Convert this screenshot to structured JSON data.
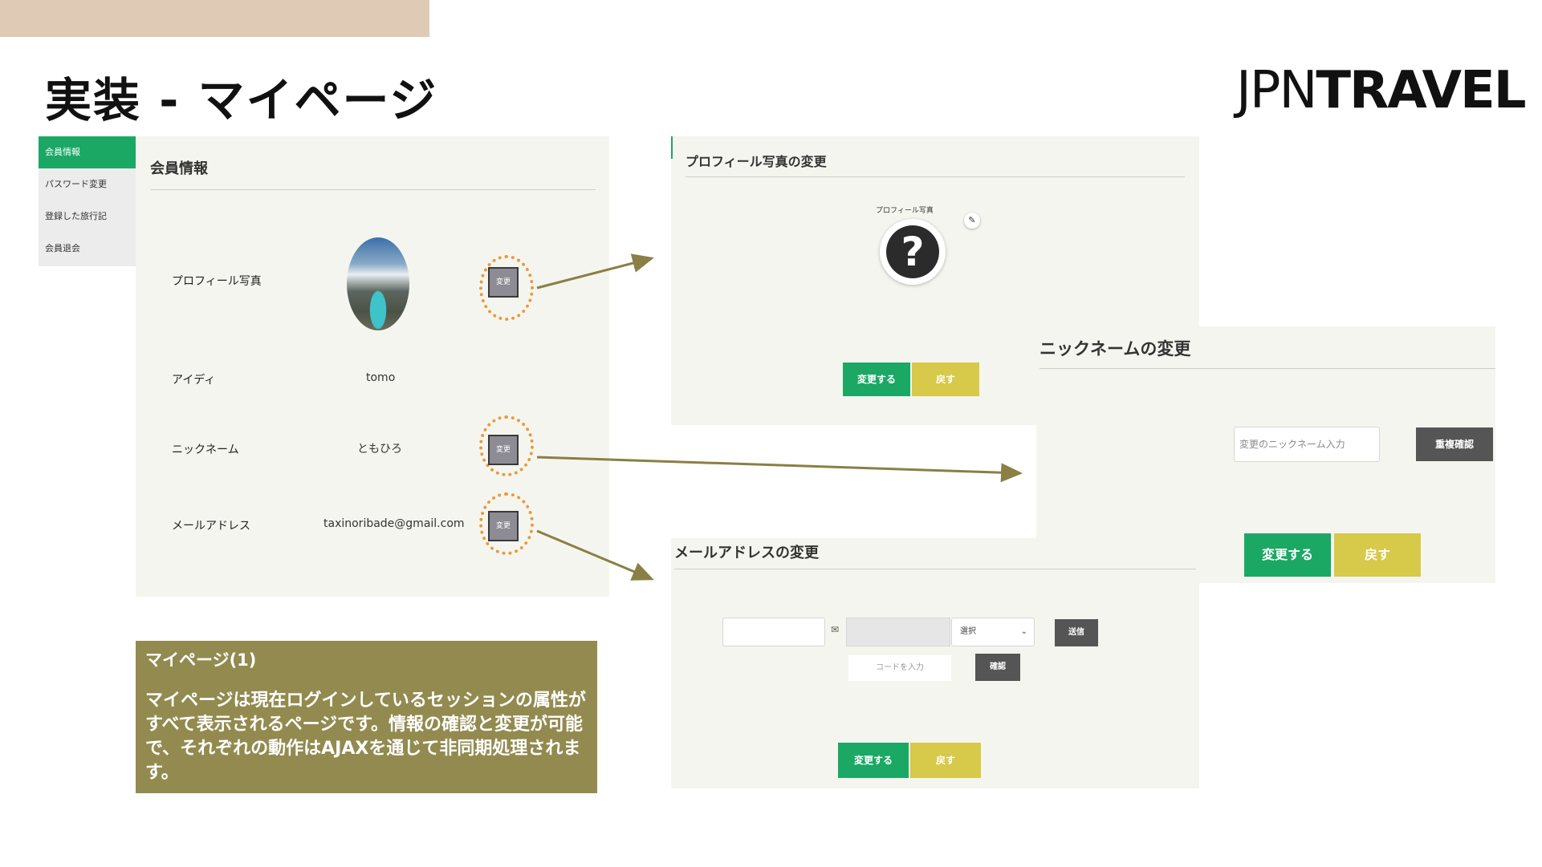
{
  "slide": {
    "title": "実装 - マイページ",
    "logo_thin": "JPN",
    "logo_bold": "TRAVEL"
  },
  "sidebar": {
    "items": [
      {
        "label": "会員情報",
        "active": true
      },
      {
        "label": "パスワード変更",
        "active": false
      },
      {
        "label": "登録した旅行記",
        "active": false
      },
      {
        "label": "会員退会",
        "active": false
      }
    ]
  },
  "member_info": {
    "heading": "会員情報",
    "rows": [
      {
        "label": "プロフィール写真",
        "value": "",
        "button": "変更"
      },
      {
        "label": "アイディ",
        "value": "tomo",
        "button": ""
      },
      {
        "label": "ニックネーム",
        "value": "ともひろ",
        "button": "変更"
      },
      {
        "label": "メールアドレス",
        "value": "taxinoribade@gmail.com",
        "button": "変更"
      }
    ]
  },
  "photo_change": {
    "heading": "プロフィール写真の変更",
    "caption": "プロフィール写真",
    "placeholder_icon": "question-mark-icon",
    "edit_icon": "pencil-icon",
    "submit_label": "変更する",
    "back_label": "戻す"
  },
  "nickname_change": {
    "heading": "ニックネームの変更",
    "input_placeholder": "変更のニックネーム入力",
    "check_label": "重複確認",
    "submit_label": "変更する",
    "back_label": "戻す"
  },
  "email_change": {
    "heading": "メールアドレスの変更",
    "envelope_icon": "envelope-icon",
    "domain_select": "選択",
    "send_label": "送信",
    "code_placeholder": "コードを入力",
    "confirm_label": "確認",
    "submit_label": "変更する",
    "back_label": "戻す"
  },
  "caption": {
    "title": "マイページ(1)",
    "body": "マイページは現在ログインしているセッションの属性がすべて表示されるページです。情報の確認と変更が可能で、それぞれの動作はAJAXを通じて非同期処理されます。"
  },
  "colors": {
    "accent_green": "#1aa864",
    "button_yellow": "#d7c949",
    "panel_bg": "#f5f5ef",
    "caption_bg": "#938a50",
    "ring_orange": "#e99a3e",
    "arrow_olive": "#8a7f45",
    "top_band": "#dfcab6"
  }
}
